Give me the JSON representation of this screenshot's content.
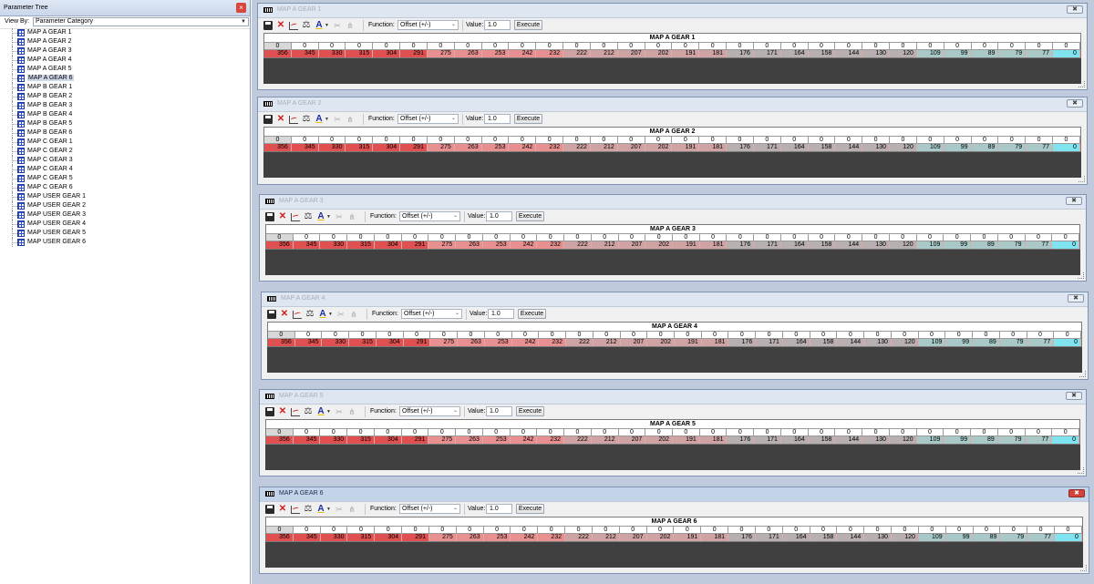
{
  "left_panel": {
    "title": "Parameter Tree",
    "close_glyph": "×",
    "view_by_label": "View By:",
    "view_by_value": "Parameter Category",
    "selected_index": 5,
    "items": [
      "MAP A GEAR 1",
      "MAP A GEAR 2",
      "MAP A GEAR 3",
      "MAP A GEAR 4",
      "MAP A GEAR 5",
      "MAP A GEAR 6",
      "MAP B GEAR 1",
      "MAP B GEAR 2",
      "MAP B GEAR 3",
      "MAP B GEAR 4",
      "MAP B GEAR 5",
      "MAP B GEAR 6",
      "MAP C GEAR 1",
      "MAP C GEAR 2",
      "MAP C GEAR 3",
      "MAP C GEAR 4",
      "MAP C GEAR 5",
      "MAP C GEAR 6",
      "MAP USER GEAR 1",
      "MAP USER GEAR 2",
      "MAP USER GEAR 3",
      "MAP USER GEAR 4",
      "MAP USER GEAR 5",
      "MAP USER GEAR 6"
    ]
  },
  "toolbar": {
    "function_label": "Function:",
    "function_value": "Offset (+/-)",
    "value_label": "Value:",
    "value_value": "1.0",
    "execute_label": "Execute"
  },
  "windows": [
    {
      "title": "MAP A GEAR 1",
      "table_title": "MAP A GEAR 1",
      "active": false
    },
    {
      "title": "MAP A GEAR 2",
      "table_title": "MAP A GEAR 2",
      "active": false
    },
    {
      "title": "MAP A GEAR 3",
      "table_title": "MAP A GEAR 3",
      "active": false
    },
    {
      "title": "MAP A GEAR 4",
      "table_title": "MAP A GEAR 4",
      "active": false
    },
    {
      "title": "MAP A GEAR 5",
      "table_title": "MAP A GEAR 5",
      "active": false
    },
    {
      "title": "MAP A GEAR 6",
      "table_title": "MAP A GEAR 6",
      "active": true
    }
  ],
  "grid": {
    "row_header_value": "0",
    "column_headers": [
      "0",
      "0",
      "0",
      "0",
      "0",
      "0",
      "0",
      "0",
      "0",
      "0",
      "0",
      "0",
      "0",
      "0",
      "0",
      "0",
      "0",
      "0",
      "0",
      "0",
      "0",
      "0",
      "0",
      "0",
      "0",
      "0",
      "0",
      "0",
      "0"
    ],
    "values": [
      356,
      345,
      330,
      315,
      304,
      291,
      275,
      263,
      253,
      242,
      232,
      222,
      212,
      207,
      202,
      191,
      181,
      176,
      171,
      164,
      158,
      144,
      130,
      120,
      109,
      99,
      89,
      79,
      77,
      0
    ],
    "colors": {
      "hot": "#e05050",
      "warm": "#e89090",
      "mid": "#cfa3a3",
      "neutral": "#b8b0b0",
      "cool": "#a9c9c9",
      "min": "#7fe4f0"
    }
  }
}
